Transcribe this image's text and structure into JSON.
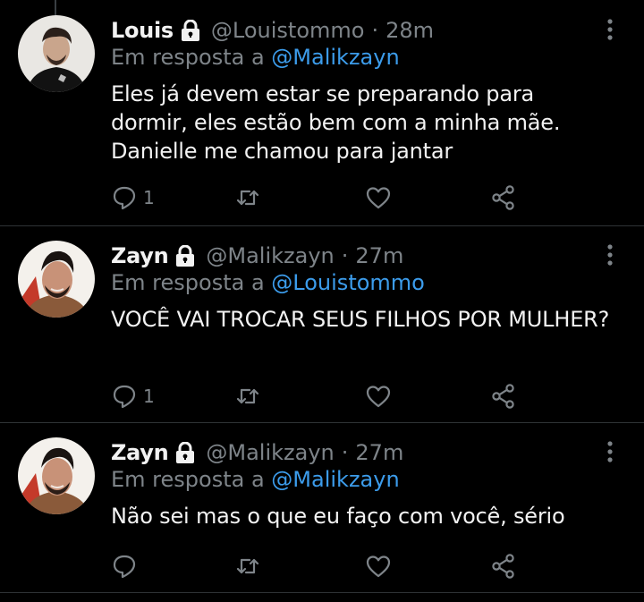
{
  "tweets": [
    {
      "name": "Louis",
      "handle": "@Louistommo",
      "time": "28m",
      "reply_prefix": "Em resposta a",
      "reply_to": "@Malikzayn",
      "text": "Eles já devem estar se preparando para dormir, eles estão bem com a minha mãe. Danielle me chamou para jantar",
      "reply_count": "1"
    },
    {
      "name": "Zayn",
      "handle": "@Malikzayn",
      "time": "27m",
      "reply_prefix": "Em resposta a",
      "reply_to": "@Louistommo",
      "text": "VOCÊ VAI TROCAR SEUS FILHOS POR MULHER?",
      "reply_count": "1"
    },
    {
      "name": "Zayn",
      "handle": "@Malikzayn",
      "time": "27m",
      "reply_prefix": "Em resposta a",
      "reply_to": "@Malikzayn",
      "text": "Não sei mas o que eu faço com você, sério",
      "reply_count": ""
    }
  ],
  "separator": "·",
  "icons": {
    "lock": "lock-icon",
    "more": "more-vertical-icon",
    "reply": "reply-icon",
    "retweet": "retweet-icon",
    "like": "heart-icon",
    "share": "share-icon"
  },
  "colors": {
    "background": "#000000",
    "text": "#f2f2f2",
    "muted": "#7e8489",
    "link": "#3c9ceb",
    "divider": "#2f3336"
  }
}
